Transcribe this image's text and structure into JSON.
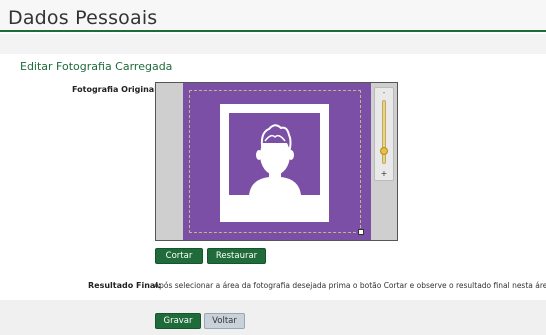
{
  "header": {
    "title": "Dados Pessoais"
  },
  "section": {
    "title": "Editar Fotografia Carregada"
  },
  "photo": {
    "label": "Fotografia Original:",
    "zoom": {
      "minus": "-",
      "plus": "+",
      "level": 0.8
    }
  },
  "actions": {
    "crop_label": "Cortar",
    "restore_label": "Restaurar"
  },
  "result": {
    "label": "Resultado Final:",
    "text": "Após selecionar a área da fotografia desejada prima o botão Cortar e observe o resultado final nesta área"
  },
  "footer": {
    "save_label": "Gravar",
    "back_label": "Voltar"
  },
  "colors": {
    "accent": "#1f6b3a",
    "photo_bg": "#7b4fa6",
    "zoom_thumb": "#e6c046"
  },
  "icons": {
    "avatar": "person-silhouette-icon",
    "crop_handle": "resize-handle-icon"
  }
}
